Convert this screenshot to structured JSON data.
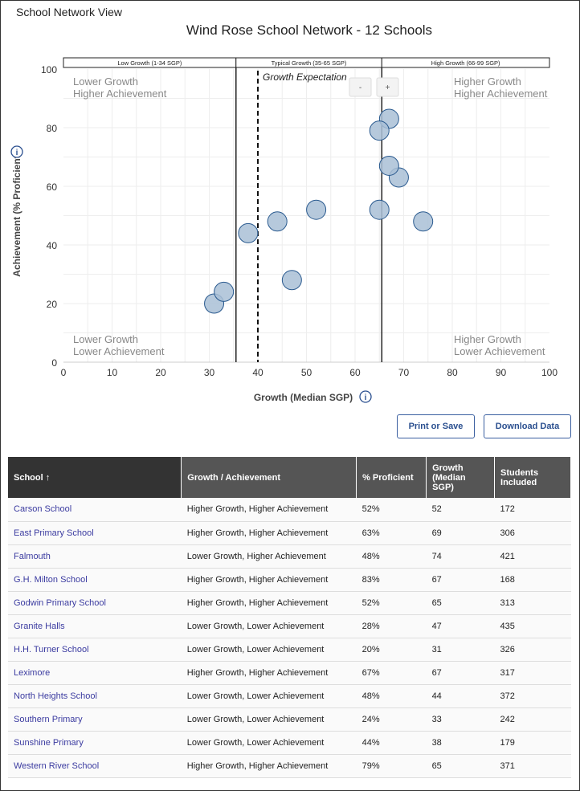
{
  "page": {
    "view_title": "School Network View"
  },
  "chart_data": {
    "type": "scatter",
    "title": "Wind Rose School Network - 12 Schools",
    "xlabel": "Growth (Median SGP)",
    "ylabel": "Achievement (% Proficient)",
    "xlim": [
      0,
      100
    ],
    "ylim": [
      0,
      100
    ],
    "xticks": [
      0,
      10,
      20,
      30,
      40,
      50,
      60,
      70,
      80,
      90,
      100
    ],
    "yticks": [
      0,
      20,
      40,
      60,
      80,
      100
    ],
    "grid": true,
    "bands": [
      "Low Growth (1-34 SGP)",
      "Typical Growth (35-65 SGP)",
      "High Growth (66-99 SGP)"
    ],
    "band_boundaries": [
      35.5,
      65.5
    ],
    "growth_expectation": {
      "label": "Growth Expectation",
      "x": 40
    },
    "quadrants": {
      "tl": [
        "Lower Growth",
        "Higher Achievement"
      ],
      "tr": [
        "Higher Growth",
        "Higher Achievement"
      ],
      "bl": [
        "Lower Growth",
        "Lower Achievement"
      ],
      "br": [
        "Higher Growth",
        "Lower Achievement"
      ]
    },
    "zoom_out": "-",
    "zoom_in": "+",
    "point_color": "#a9bfd6",
    "points": [
      {
        "name": "Carson School",
        "x": 52,
        "y": 52
      },
      {
        "name": "East Primary School",
        "x": 69,
        "y": 63
      },
      {
        "name": "Falmouth",
        "x": 74,
        "y": 48
      },
      {
        "name": "G.H. Milton School",
        "x": 67,
        "y": 83
      },
      {
        "name": "Godwin Primary School",
        "x": 65,
        "y": 52
      },
      {
        "name": "Granite Halls",
        "x": 47,
        "y": 28
      },
      {
        "name": "H.H. Turner School",
        "x": 31,
        "y": 20
      },
      {
        "name": "Leximore",
        "x": 67,
        "y": 67
      },
      {
        "name": "North Heights School",
        "x": 44,
        "y": 48
      },
      {
        "name": "Southern Primary",
        "x": 33,
        "y": 24
      },
      {
        "name": "Sunshine Primary",
        "x": 38,
        "y": 44
      },
      {
        "name": "Western River School",
        "x": 65,
        "y": 79
      }
    ]
  },
  "buttons": {
    "print": "Print or Save",
    "download": "Download Data"
  },
  "table": {
    "headers": [
      "School ↑",
      "Growth / Achievement",
      "% Proficient",
      "Growth (Median SGP)",
      "Students Included"
    ],
    "rows": [
      [
        "Carson School",
        "Higher Growth, Higher Achievement",
        "52%",
        "52",
        "172"
      ],
      [
        "East Primary School",
        "Higher Growth, Higher Achievement",
        "63%",
        "69",
        "306"
      ],
      [
        "Falmouth",
        "Lower Growth, Higher Achievement",
        "48%",
        "74",
        "421"
      ],
      [
        "G.H. Milton School",
        "Higher Growth, Higher Achievement",
        "83%",
        "67",
        "168"
      ],
      [
        "Godwin Primary School",
        "Higher Growth, Higher Achievement",
        "52%",
        "65",
        "313"
      ],
      [
        "Granite Halls",
        "Lower Growth, Lower Achievement",
        "28%",
        "47",
        "435"
      ],
      [
        "H.H. Turner School",
        "Lower Growth, Lower Achievement",
        "20%",
        "31",
        "326"
      ],
      [
        "Leximore",
        "Higher Growth, Higher Achievement",
        "67%",
        "67",
        "317"
      ],
      [
        "North Heights School",
        "Lower Growth, Lower Achievement",
        "48%",
        "44",
        "372"
      ],
      [
        "Southern Primary",
        "Lower Growth, Lower Achievement",
        "24%",
        "33",
        "242"
      ],
      [
        "Sunshine Primary",
        "Lower Growth, Lower Achievement",
        "44%",
        "38",
        "179"
      ],
      [
        "Western River School",
        "Higher Growth, Higher Achievement",
        "79%",
        "65",
        "371"
      ]
    ]
  }
}
